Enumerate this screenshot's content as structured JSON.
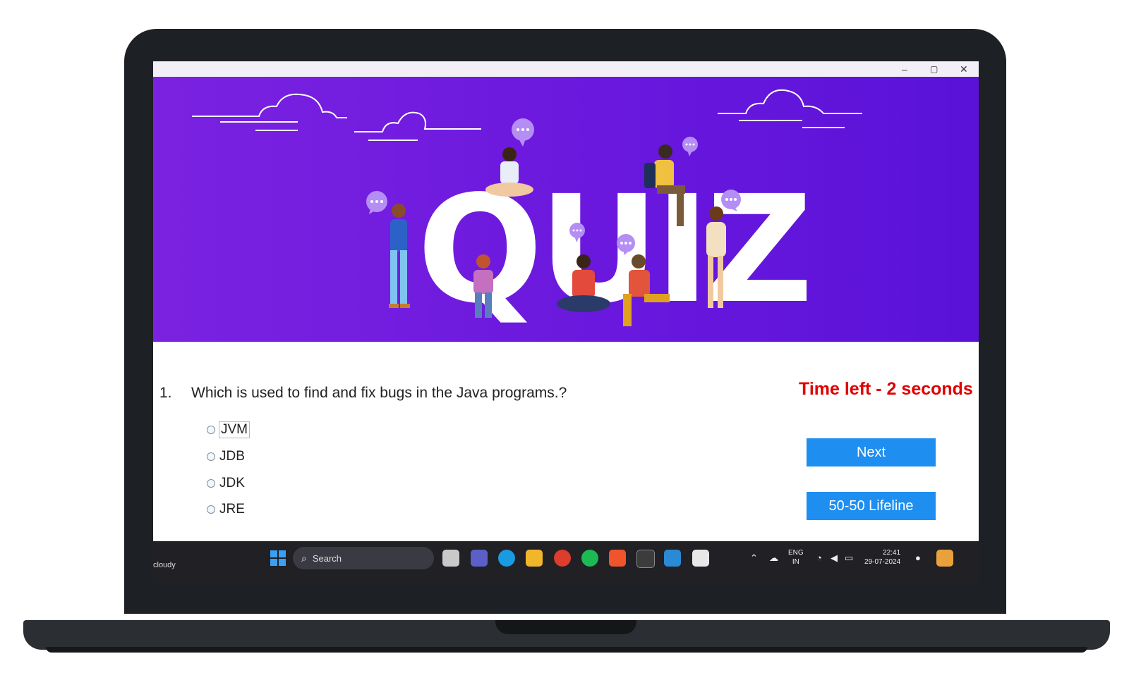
{
  "window": {
    "minimize": "–",
    "restore": "▢",
    "close": "✕"
  },
  "banner": {
    "title": "QUIZ"
  },
  "question": {
    "number": "1.",
    "text": "Which is used to find and fix bugs in the Java programs.?"
  },
  "timer": "Time left - 2 seconds",
  "options": [
    "JVM",
    "JDB",
    "JDK",
    "JRE"
  ],
  "buttons": {
    "next": "Next",
    "lifeline": "50-50 Lifeline"
  },
  "taskbar": {
    "weather": "cloudy",
    "search_label": "Search",
    "lang_line1": "ENG",
    "lang_line2": "IN",
    "time": "22:41",
    "date": "29-07-2024",
    "apps": [
      "file-explorer-thumbnail",
      "teams",
      "edge",
      "file-explorer",
      "chrome",
      "spotify",
      "brave",
      "terminal",
      "vscode",
      "java-app"
    ]
  },
  "colors": {
    "banner": "#6a18de",
    "accent": "#1e8ef0",
    "timer": "#e00000",
    "taskbar": "#202025"
  }
}
